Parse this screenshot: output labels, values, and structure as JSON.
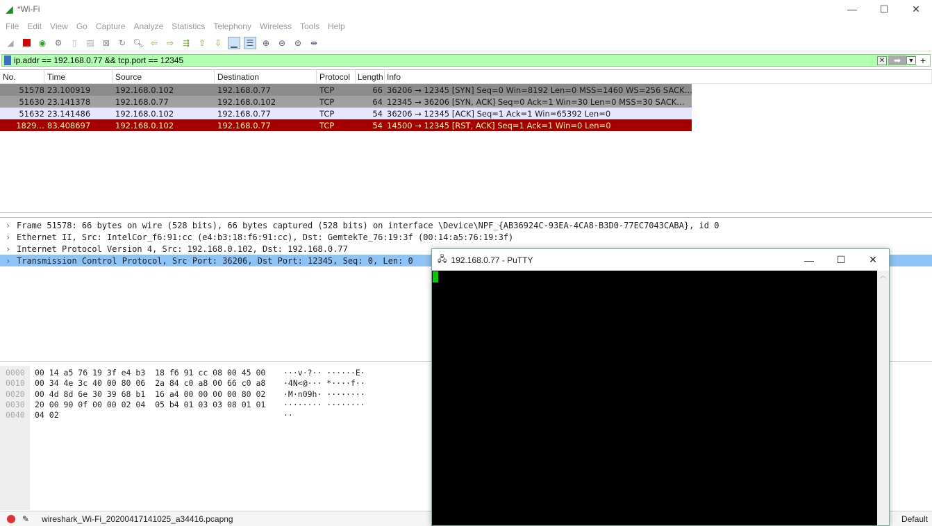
{
  "window": {
    "title": "*Wi-Fi",
    "min": "—",
    "max": "☐",
    "close": "✕"
  },
  "menu": [
    "File",
    "Edit",
    "View",
    "Go",
    "Capture",
    "Analyze",
    "Statistics",
    "Telephony",
    "Wireless",
    "Tools",
    "Help"
  ],
  "filter": {
    "value": "ip.addr == 192.168.0.77 && tcp.port == 12345"
  },
  "columns": [
    "No.",
    "Time",
    "Source",
    "Destination",
    "Protocol",
    "Length",
    "Info"
  ],
  "packets": [
    {
      "no": "51578",
      "time": "23.100919",
      "src": "192.168.0.102",
      "dst": "192.168.0.77",
      "proto": "TCP",
      "len": "66",
      "info": "36206 → 12345 [SYN] Seq=0 Win=8192 Len=0 MSS=1460 WS=256 SACK…",
      "bg": "#8c8c8c",
      "fg": "#1a1a1a"
    },
    {
      "no": "51630",
      "time": "23.141378",
      "src": "192.168.0.77",
      "dst": "192.168.0.102",
      "proto": "TCP",
      "len": "64",
      "info": "12345 → 36206 [SYN, ACK] Seq=0 Ack=1 Win=30 Len=0 MSS=30 SACK…",
      "bg": "#a0a0a0",
      "fg": "#1a1a1a"
    },
    {
      "no": "51632",
      "time": "23.141486",
      "src": "192.168.0.102",
      "dst": "192.168.0.77",
      "proto": "TCP",
      "len": "54",
      "info": "36206 → 12345 [ACK] Seq=1 Ack=1 Win=65392 Len=0",
      "bg": "#e7e6ff",
      "fg": "#1a1a1a"
    },
    {
      "no": "1829…",
      "time": "83.408697",
      "src": "192.168.0.102",
      "dst": "192.168.0.77",
      "proto": "TCP",
      "len": "54",
      "info": "14500 → 12345 [RST, ACK] Seq=1 Ack=1 Win=0 Len=0",
      "bg": "#a40000",
      "fg": "#fffc9c"
    }
  ],
  "details": [
    "Frame 51578: 66 bytes on wire (528 bits), 66 bytes captured (528 bits) on interface \\Device\\NPF_{AB36924C-93EA-4CA8-B3D0-77EC7043CABA}, id 0",
    "Ethernet II, Src: IntelCor_f6:91:cc (e4:b3:18:f6:91:cc), Dst: GemtekTe_76:19:3f (00:14:a5:76:19:3f)",
    "Internet Protocol Version 4, Src: 192.168.0.102, Dst: 192.168.0.77",
    "Transmission Control Protocol, Src Port: 36206, Dst Port: 12345, Seq: 0, Len: 0"
  ],
  "hex": {
    "offsets": [
      "0000",
      "0010",
      "0020",
      "0030",
      "0040"
    ],
    "bytes": [
      "00 14 a5 76 19 3f e4 b3  18 f6 91 cc 08 00 45 00",
      "00 34 4e 3c 40 00 80 06  2a 84 c0 a8 00 66 c0 a8",
      "00 4d 8d 6e 30 39 68 b1  16 a4 00 00 00 00 80 02",
      "20 00 90 0f 00 00 02 04  05 b4 01 03 03 08 01 01",
      "04 02"
    ],
    "ascii": [
      "···v·?·· ······E·",
      "·4N<@··· *····f··",
      "·M·n09h· ········",
      "········ ········",
      "··"
    ]
  },
  "status": {
    "file": "wireshark_Wi-Fi_20200417141025_a34416.pcapng",
    "profile": "Default"
  },
  "putty": {
    "title": "192.168.0.77 - PuTTY"
  }
}
